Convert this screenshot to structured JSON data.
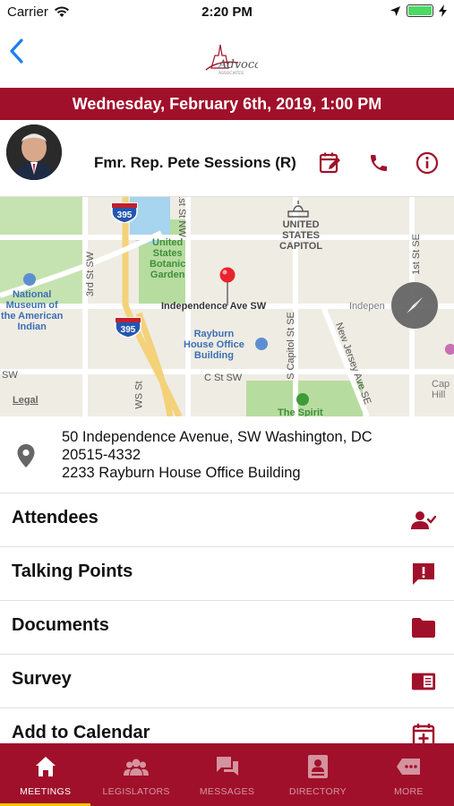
{
  "status_bar": {
    "carrier": "Carrier",
    "time": "2:20 PM"
  },
  "nav": {
    "logo_text": "Advocacy",
    "logo_subtext": "ASSOCIATES"
  },
  "meeting": {
    "datetime": "Wednesday, February 6th, 2019, 1:00 PM",
    "rep_name": "Fmr. Rep. Pete Sessions (R)"
  },
  "map": {
    "labels": {
      "capitol": "UNITED\nSTATES\nCAPITOL",
      "botanic": "United\nStates\nBotanic\nGarden",
      "museum": "National\nMuseum of\nthe American\nIndian",
      "rayburn": "Rayburn\nHouse Office\nBuilding",
      "independence": "Independence Ave SW",
      "independence2": "Indepen",
      "c_st": "C St SW",
      "sw": "SW",
      "spirit": "The Spirit",
      "third_st": "3rd St SW",
      "first_st_nw": "1st St NW",
      "first_st_se": "1st St SE",
      "s_capitol": "S Capitol St SE",
      "new_jersey": "New Jersey Ave SE",
      "ws_st": "WS St",
      "shield_395_a": "395",
      "shield_395_b": "395",
      "legal": "Legal",
      "cap": "Cap\nHill"
    }
  },
  "address": {
    "line1": "50 Independence Avenue, SW Washington, DC",
    "line2": "20515-4332",
    "line3": "2233 Rayburn House Office Building"
  },
  "menu": [
    {
      "label": "Attendees",
      "icon": "attendees-icon"
    },
    {
      "label": "Talking Points",
      "icon": "talking-points-icon"
    },
    {
      "label": "Documents",
      "icon": "folder-icon"
    },
    {
      "label": "Survey",
      "icon": "survey-icon"
    },
    {
      "label": "Add to Calendar",
      "icon": "calendar-add-icon"
    }
  ],
  "tabs": [
    {
      "label": "MEETINGS",
      "icon": "home-icon",
      "active": true
    },
    {
      "label": "LEGISLATORS",
      "icon": "legislators-icon",
      "active": false
    },
    {
      "label": "MESSAGES",
      "icon": "messages-icon",
      "active": false
    },
    {
      "label": "DIRECTORY",
      "icon": "directory-icon",
      "active": false
    },
    {
      "label": "MORE",
      "icon": "more-icon",
      "active": false
    }
  ],
  "colors": {
    "brand": "#a0102a",
    "active_tab_underline": "#f5c400",
    "map_water": "#a7d4ee",
    "map_park": "#b7dca0"
  }
}
